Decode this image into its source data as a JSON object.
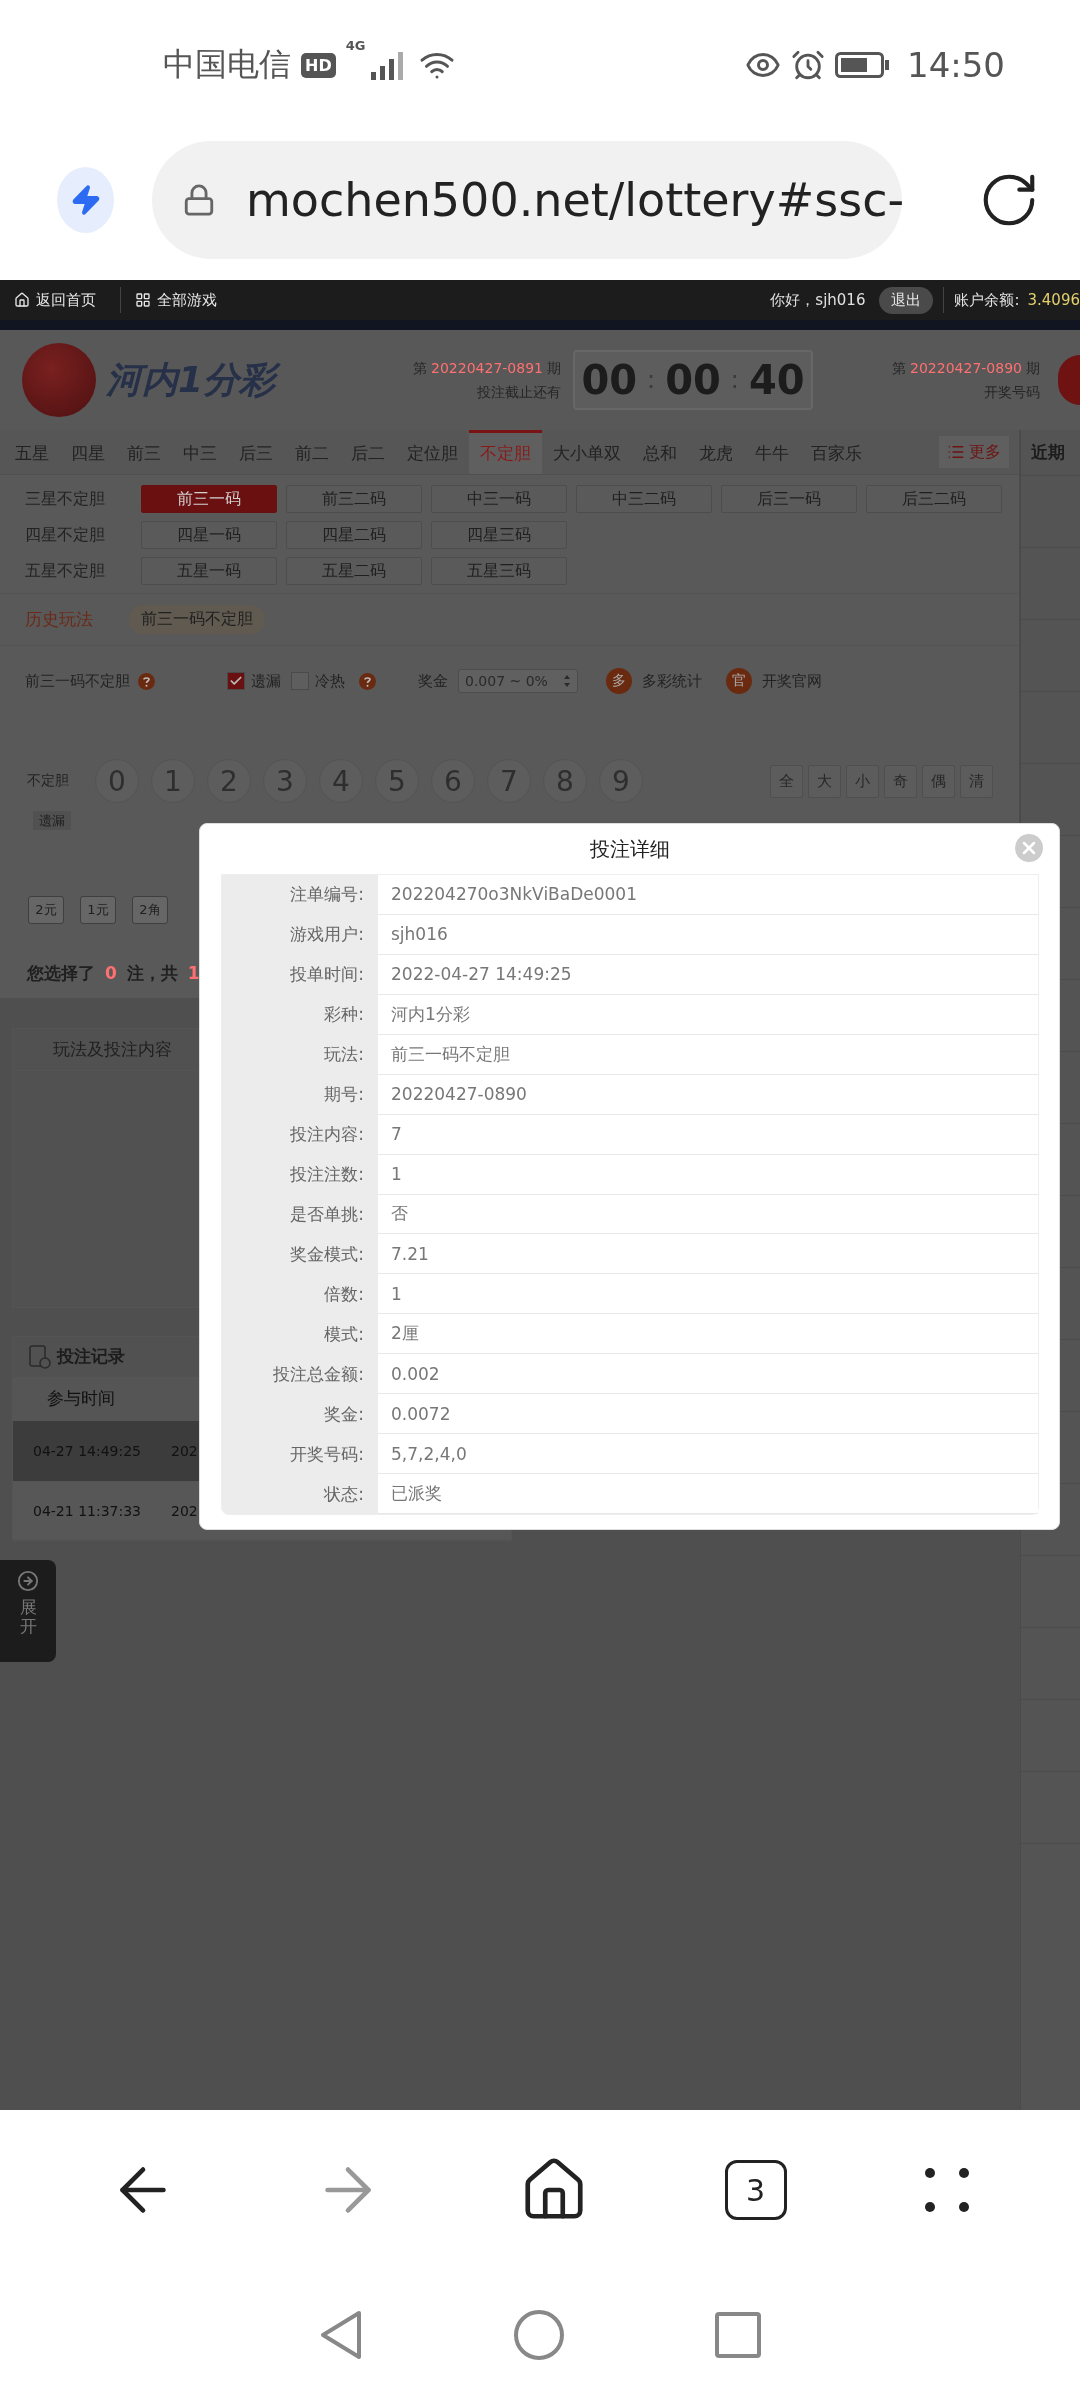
{
  "status_bar": {
    "carrier": "中国电信",
    "hd": "HD",
    "network": "4G",
    "time": "14:50"
  },
  "browser": {
    "url": "mochen500.net/lottery#ssc-",
    "tab_count": "3"
  },
  "top_nav": {
    "home": "返回首页",
    "all_games": "全部游戏",
    "greeting": "你好，sjh016",
    "logout": "退出",
    "balance_label": "账户余额:",
    "balance": "3.4096"
  },
  "game_header": {
    "title": "河内1分彩",
    "current_issue": {
      "prefix": "第",
      "number": "20220427-0891",
      "suffix": "期",
      "caption": "投注截止还有"
    },
    "countdown": {
      "parts": [
        "00",
        "00",
        "40"
      ],
      "separator": ":"
    },
    "last_issue": {
      "prefix": "第",
      "number": "20220427-0890",
      "suffix": "期",
      "caption": "开奖号码"
    }
  },
  "tabs": [
    {
      "label": "五星",
      "selected": false
    },
    {
      "label": "四星",
      "selected": false
    },
    {
      "label": "前三",
      "selected": false
    },
    {
      "label": "中三",
      "selected": false
    },
    {
      "label": "后三",
      "selected": false
    },
    {
      "label": "前二",
      "selected": false
    },
    {
      "label": "后二",
      "selected": false
    },
    {
      "label": "定位胆",
      "selected": false
    },
    {
      "label": "不定胆",
      "selected": true
    },
    {
      "label": "大小单双",
      "selected": false
    },
    {
      "label": "总和",
      "selected": false
    },
    {
      "label": "龙虎",
      "selected": false
    },
    {
      "label": "牛牛",
      "selected": false
    },
    {
      "label": "百家乐",
      "selected": false
    }
  ],
  "more": "更多",
  "right_panel": {
    "title": "近期"
  },
  "subplays": [
    {
      "group": "三星不定胆",
      "options": [
        {
          "label": "前三一码",
          "selected": true
        },
        {
          "label": "前三二码",
          "selected": false
        },
        {
          "label": "中三一码",
          "selected": false
        },
        {
          "label": "中三二码",
          "selected": false
        },
        {
          "label": "后三一码",
          "selected": false
        },
        {
          "label": "后三二码",
          "selected": false
        }
      ]
    },
    {
      "group": "四星不定胆",
      "options": [
        {
          "label": "四星一码",
          "selected": false
        },
        {
          "label": "四星二码",
          "selected": false
        },
        {
          "label": "四星三码",
          "selected": false
        }
      ]
    },
    {
      "group": "五星不定胆",
      "options": [
        {
          "label": "五星一码",
          "selected": false
        },
        {
          "label": "五星二码",
          "selected": false
        },
        {
          "label": "五星三码",
          "selected": false
        }
      ]
    }
  ],
  "history": {
    "label": "历史玩法",
    "items": [
      "前三一码不定胆"
    ]
  },
  "options": {
    "play_name": "前三一码不定胆",
    "toggles": [
      {
        "label": "遗漏",
        "checked": true,
        "help": false
      },
      {
        "label": "冷热",
        "checked": false,
        "help": true
      }
    ],
    "prize_label": "奖金",
    "prize_value": "0.007 ~ 0%",
    "links": [
      {
        "badge": "多",
        "label": "多彩统计"
      },
      {
        "badge": "官",
        "label": "开奖官网"
      }
    ]
  },
  "ball_row": {
    "label": "不定胆",
    "balls": [
      {
        "number": "0",
        "selected": false
      },
      {
        "number": "1",
        "selected": false
      },
      {
        "number": "2",
        "selected": false
      },
      {
        "number": "3",
        "selected": false
      },
      {
        "number": "4",
        "selected": false
      },
      {
        "number": "5",
        "selected": false
      },
      {
        "number": "6",
        "selected": false
      },
      {
        "number": "7",
        "selected": false
      },
      {
        "number": "8",
        "selected": false
      },
      {
        "number": "9",
        "selected": false
      }
    ],
    "quick": [
      "全",
      "大",
      "小",
      "奇",
      "偶",
      "清"
    ],
    "missing_label": "遗漏"
  },
  "units": [
    "2元",
    "1元",
    "2角"
  ],
  "summary": {
    "prefix": "您选择了",
    "count": "0",
    "middle": "注，共",
    "total": "1"
  },
  "bet_panel": {
    "title": "玩法及投注内容"
  },
  "records": {
    "title": "投注记录",
    "columns": [
      "参与时间"
    ],
    "rows": [
      {
        "time": "04-27 14:49:25",
        "column_2": "202",
        "selected": true
      },
      {
        "time": "04-21 11:37:33",
        "column_2": "202",
        "selected": false
      }
    ]
  },
  "side_tab": {
    "label": "展开"
  },
  "modal": {
    "title": "投注详细",
    "rows": [
      {
        "label": "注单编号:",
        "value": "202204270o3NkViBaDe0001"
      },
      {
        "label": "游戏用户:",
        "value": "sjh016"
      },
      {
        "label": "投单时间:",
        "value": "2022-04-27 14:49:25"
      },
      {
        "label": "彩种:",
        "value": "河内1分彩"
      },
      {
        "label": "玩法:",
        "value": "前三一码不定胆"
      },
      {
        "label": "期号:",
        "value": "20220427-0890"
      },
      {
        "label": "投注内容:",
        "value": "7"
      },
      {
        "label": "投注注数:",
        "value": "1"
      },
      {
        "label": "是否单挑:",
        "value": "否"
      },
      {
        "label": "奖金模式:",
        "value": "7.21"
      },
      {
        "label": "倍数:",
        "value": "1"
      },
      {
        "label": "模式:",
        "value": "2厘"
      },
      {
        "label": "投注总金额:",
        "value": "0.002"
      },
      {
        "label": "奖金:",
        "value": "0.0072"
      },
      {
        "label": "开奖号码:",
        "value": "5,7,2,4,0"
      },
      {
        "label": "状态:",
        "value": "已派奖"
      }
    ]
  }
}
